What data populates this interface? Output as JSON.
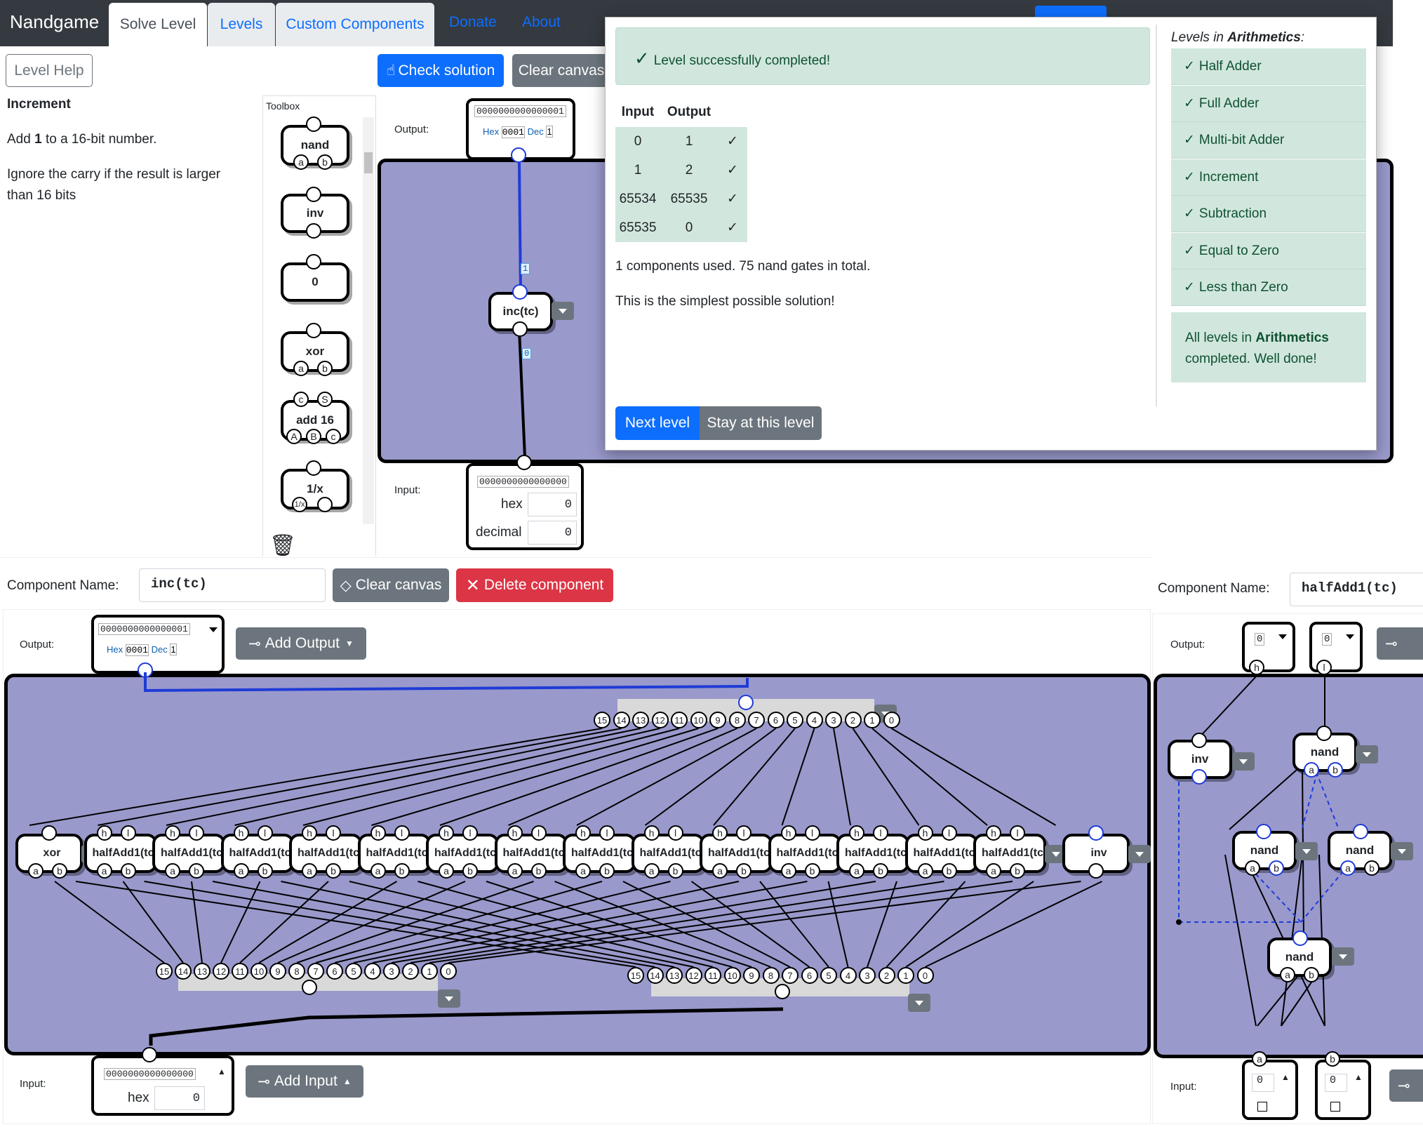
{
  "nav": {
    "brand": "Nandgame",
    "tabs": [
      "Solve Level",
      "Levels",
      "Custom Components"
    ],
    "links": [
      "Donate",
      "About"
    ]
  },
  "toolbar": {
    "level_help": "Level Help",
    "check_solution": "Check solution",
    "clear_canvas": "Clear canvas"
  },
  "level": {
    "title": "Increment",
    "desc_prefix": "Add ",
    "desc_bold": "1",
    "desc_suffix": " to a 16-bit number.",
    "desc2_line1": "Ignore the carry if the result is larger",
    "desc2_line2": "than 16 bits"
  },
  "toolbox": {
    "title": "Toolbox",
    "items": [
      {
        "name": "nand",
        "pins": [
          "a",
          "b"
        ]
      },
      {
        "name": "inv",
        "pins": []
      },
      {
        "name": "0",
        "pins": []
      },
      {
        "name": "xor",
        "pins": [
          "a",
          "b"
        ]
      },
      {
        "name": "add 16",
        "pins": [
          "A",
          "B",
          "c"
        ],
        "top_pins": [
          "c",
          "S"
        ]
      },
      {
        "name": "1/x",
        "pins": [
          "1/x"
        ]
      }
    ]
  },
  "top_canvas": {
    "output_label": "Output:",
    "output_value": "0000000000000001",
    "hex_label": "Hex",
    "hex_value": "0001",
    "dec_label": "Dec",
    "dec_value": "1",
    "component": "inc(tc)",
    "wire_value_1": "1",
    "wire_value_0": "0",
    "input_label": "Input:",
    "input_value": "0000000000000000",
    "hex_field_label": "hex",
    "hex_field_value": "0",
    "decimal_field_label": "decimal",
    "decimal_field_value": "0"
  },
  "modal": {
    "success": "Level successfully completed!",
    "table_headers": [
      "Input",
      "Output"
    ],
    "rows": [
      {
        "input": "0",
        "output": "1",
        "check": "✓"
      },
      {
        "input": "1",
        "output": "2",
        "check": "✓"
      },
      {
        "input": "65534",
        "output": "65535",
        "check": "✓"
      },
      {
        "input": "65535",
        "output": "0",
        "check": "✓"
      }
    ],
    "usage": "1 components used. 75 nand gates in total.",
    "simplest": "This is the simplest possible solution!",
    "next_level": "Next level",
    "stay": "Stay at this level",
    "levels_prefix": "Levels in ",
    "levels_category": "Arithmetics",
    "levels_suffix": ":",
    "levels": [
      "Half Adder",
      "Full Adder",
      "Multi-bit Adder",
      "Increment",
      "Subtraction",
      "Equal to Zero",
      "Less than Zero"
    ],
    "done_prefix": "All levels in ",
    "done_category": "Arithmetics",
    "done_suffix": " completed. Well done!"
  },
  "editor1": {
    "name_label": "Component Name:",
    "name_value": "inc(tc)",
    "clear_canvas": "Clear canvas",
    "delete_component": "Delete component",
    "output_label": "Output:",
    "output_value": "0000000000000001",
    "hex_label": "Hex",
    "hex_value": "0001",
    "dec_label": "Dec",
    "dec_value": "1",
    "add_output": "Add Output",
    "input_label": "Input:",
    "input_value": "0000000000000000",
    "hex_field_label": "hex",
    "hex_field_value": "0",
    "add_input": "Add Input",
    "gates": [
      "xor",
      "halfAdd1(tc)",
      "halfAdd1(tc)",
      "halfAdd1(tc)",
      "halfAdd1(tc)",
      "halfAdd1(tc)",
      "halfAdd1(tc)",
      "halfAdd1(tc)",
      "halfAdd1(tc)",
      "halfAdd1(tc)",
      "halfAdd1(tc)",
      "halfAdd1(tc)",
      "halfAdd1(tc)",
      "halfAdd1(tc)",
      "halfAdd1(tc)",
      "inv"
    ],
    "bus_bits": [
      "15",
      "14",
      "13",
      "12",
      "11",
      "10",
      "9",
      "8",
      "7",
      "6",
      "5",
      "4",
      "3",
      "2",
      "1",
      "0"
    ]
  },
  "editor2": {
    "name_label": "Component Name:",
    "name_value": "halfAdd1(tc)",
    "output_label": "Output:",
    "out_h": "0",
    "out_l": "0",
    "gates": [
      "inv",
      "nand",
      "nand",
      "nand",
      "nand"
    ],
    "input_label": "Input:",
    "in_a": "0",
    "in_b": "0"
  },
  "colors": {
    "navbar": "#343a40",
    "canvas": "#9999cc",
    "primary": "#0d6efd",
    "secondary": "#6c757d",
    "danger": "#dc3545",
    "success_bg": "#d1e7dd"
  }
}
